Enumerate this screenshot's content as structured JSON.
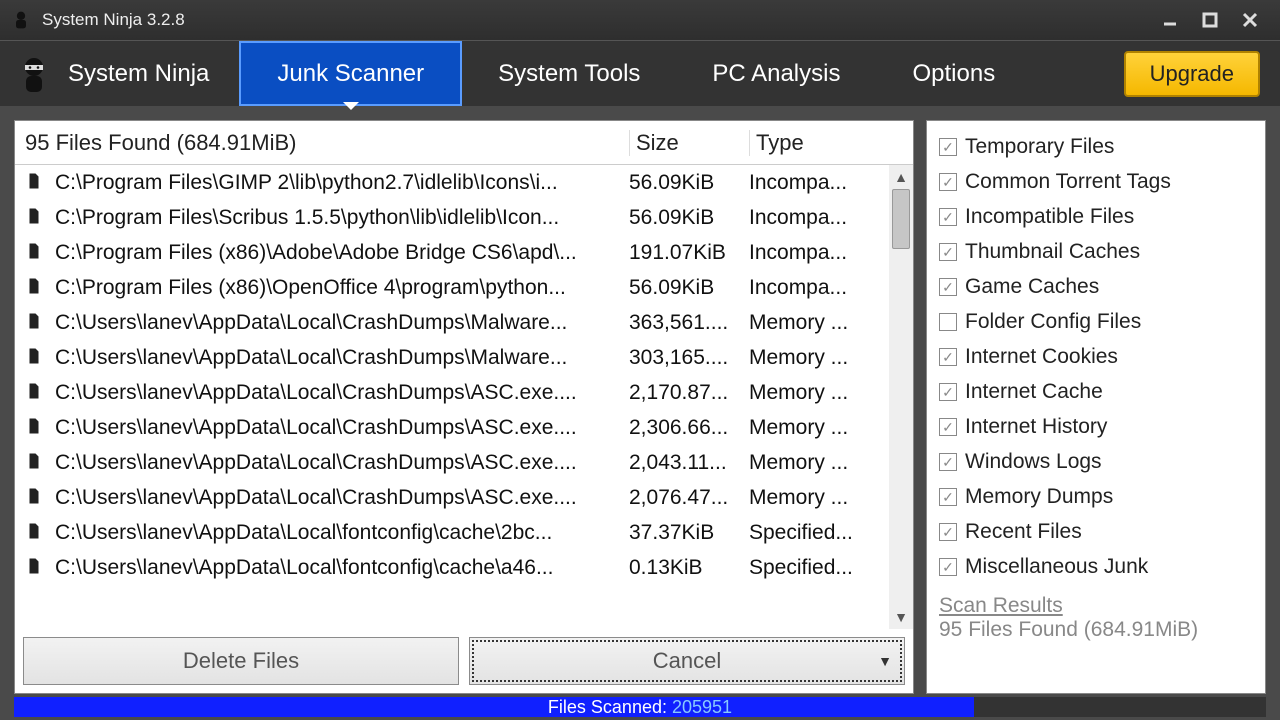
{
  "window": {
    "title": "System Ninja 3.2.8"
  },
  "brand": {
    "label": "System Ninja"
  },
  "tabs": [
    {
      "label": "Junk Scanner",
      "active": true
    },
    {
      "label": "System Tools",
      "active": false
    },
    {
      "label": "PC Analysis",
      "active": false
    },
    {
      "label": "Options",
      "active": false
    }
  ],
  "upgrade_label": "Upgrade",
  "list_header": {
    "path": "95 Files Found (684.91MiB)",
    "size": "Size",
    "type": "Type"
  },
  "rows": [
    {
      "path": "C:\\Program Files\\GIMP 2\\lib\\python2.7\\idlelib\\Icons\\i...",
      "size": "56.09KiB",
      "type": "Incompa..."
    },
    {
      "path": "C:\\Program Files\\Scribus 1.5.5\\python\\lib\\idlelib\\Icon...",
      "size": "56.09KiB",
      "type": "Incompa..."
    },
    {
      "path": "C:\\Program Files (x86)\\Adobe\\Adobe Bridge CS6\\apd\\...",
      "size": "191.07KiB",
      "type": "Incompa..."
    },
    {
      "path": "C:\\Program Files (x86)\\OpenOffice 4\\program\\python...",
      "size": "56.09KiB",
      "type": "Incompa..."
    },
    {
      "path": "C:\\Users\\lanev\\AppData\\Local\\CrashDumps\\Malware...",
      "size": "363,561....",
      "type": "Memory ..."
    },
    {
      "path": "C:\\Users\\lanev\\AppData\\Local\\CrashDumps\\Malware...",
      "size": "303,165....",
      "type": "Memory ..."
    },
    {
      "path": "C:\\Users\\lanev\\AppData\\Local\\CrashDumps\\ASC.exe....",
      "size": "2,170.87...",
      "type": "Memory ..."
    },
    {
      "path": "C:\\Users\\lanev\\AppData\\Local\\CrashDumps\\ASC.exe....",
      "size": "2,306.66...",
      "type": "Memory ..."
    },
    {
      "path": "C:\\Users\\lanev\\AppData\\Local\\CrashDumps\\ASC.exe....",
      "size": "2,043.11...",
      "type": "Memory ..."
    },
    {
      "path": "C:\\Users\\lanev\\AppData\\Local\\CrashDumps\\ASC.exe....",
      "size": "2,076.47...",
      "type": "Memory ..."
    },
    {
      "path": "C:\\Users\\lanev\\AppData\\Local\\fontconfig\\cache\\2bc...",
      "size": "37.37KiB",
      "type": "Specified..."
    },
    {
      "path": "C:\\Users\\lanev\\AppData\\Local\\fontconfig\\cache\\a46...",
      "size": "0.13KiB",
      "type": "Specified..."
    }
  ],
  "buttons": {
    "delete": "Delete Files",
    "cancel": "Cancel"
  },
  "filters": [
    {
      "label": "Temporary Files",
      "checked": true
    },
    {
      "label": "Common Torrent Tags",
      "checked": true
    },
    {
      "label": "Incompatible Files",
      "checked": true
    },
    {
      "label": "Thumbnail Caches",
      "checked": true
    },
    {
      "label": "Game Caches",
      "checked": true
    },
    {
      "label": "Folder Config Files",
      "checked": false
    },
    {
      "label": "Internet Cookies",
      "checked": true
    },
    {
      "label": "Internet Cache",
      "checked": true
    },
    {
      "label": "Internet History",
      "checked": true
    },
    {
      "label": "Windows Logs",
      "checked": true
    },
    {
      "label": "Memory Dumps",
      "checked": true
    },
    {
      "label": "Recent Files",
      "checked": true
    },
    {
      "label": "Miscellaneous Junk",
      "checked": true
    }
  ],
  "scan_results": {
    "head": "Scan Results",
    "sub": "95 Files Found (684.91MiB)"
  },
  "status": {
    "label": "Files Scanned:",
    "count": "205951"
  }
}
